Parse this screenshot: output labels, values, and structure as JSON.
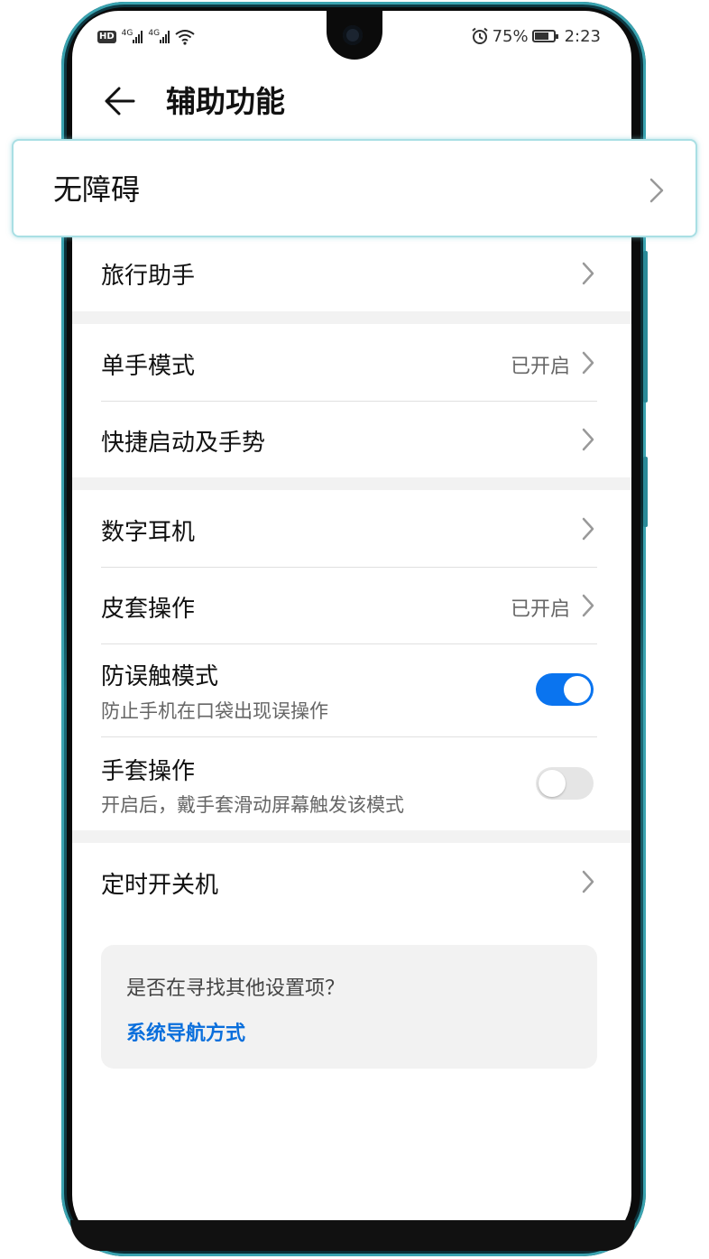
{
  "status_bar": {
    "hd": "HD",
    "net1": "4G",
    "net2": "4G",
    "battery": "75%",
    "time": "2:23"
  },
  "header": {
    "title": "辅助功能"
  },
  "highlighted_item": {
    "label": "无障碍"
  },
  "items": [
    {
      "label": "旅行助手"
    },
    {
      "label": "单手模式",
      "value": "已开启"
    },
    {
      "label": "快捷启动及手势"
    },
    {
      "label": "数字耳机"
    },
    {
      "label": "皮套操作",
      "value": "已开启"
    },
    {
      "label": "防误触模式",
      "subtitle": "防止手机在口袋出现误操作",
      "toggle": true
    },
    {
      "label": "手套操作",
      "subtitle": "开启后，戴手套滑动屏幕触发该模式",
      "toggle": false
    },
    {
      "label": "定时开关机"
    }
  ],
  "suggestion": {
    "question": "是否在寻找其他设置项？",
    "link": "系统导航方式"
  },
  "colors": {
    "accent": "#0a74ef",
    "link": "#0a6fdc",
    "highlight_border": "#a9dfe4"
  }
}
